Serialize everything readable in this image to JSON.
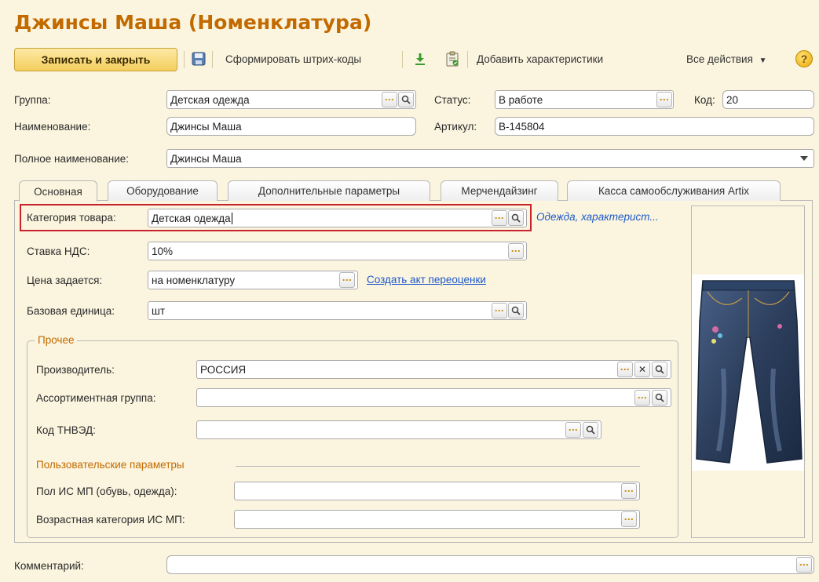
{
  "title": "Джинсы Маша (Номенклатура)",
  "toolbar": {
    "save_close": "Записать и закрыть",
    "generate_barcodes": "Сформировать штрих-коды",
    "add_characteristics": "Добавить характеристики",
    "all_actions": "Все действия",
    "help": "?"
  },
  "header": {
    "group_label": "Группа:",
    "group_value": "Детская одежда",
    "status_label": "Статус:",
    "status_value": "В работе",
    "code_label": "Код:",
    "code_value": "20",
    "name_label": "Наименование:",
    "name_value": "Джинсы Маша",
    "article_label": "Артикул:",
    "article_value": "В-145804",
    "fullname_label": "Полное наименование:",
    "fullname_value": "Джинсы Маша"
  },
  "tabs": [
    {
      "label": "Основная",
      "active": true
    },
    {
      "label": "Оборудование",
      "active": false
    },
    {
      "label": "Дополнительные параметры",
      "active": false
    },
    {
      "label": "Мерчендайзинг",
      "active": false
    },
    {
      "label": "Касса самообслуживания Artix",
      "active": false
    }
  ],
  "main": {
    "category_label": "Категория товара:",
    "category_value": "Детская одежда",
    "category_link": "Одежда, характерист...",
    "vat_label": "Ставка НДС:",
    "vat_value": "10%",
    "price_label": "Цена задается:",
    "price_value": "на номенклатуру",
    "price_link": "Создать акт переоценки",
    "unit_label": "Базовая единица:",
    "unit_value": "шт"
  },
  "other": {
    "legend": "Прочее",
    "manufacturer_label": "Производитель:",
    "manufacturer_value": "РОССИЯ",
    "assortment_label": "Ассортиментная группа:",
    "assortment_value": "",
    "tnved_label": "Код ТНВЭД:",
    "tnved_value": "",
    "user_params_legend": "Пользовательские параметры",
    "gender_label": "Пол ИС МП (обувь, одежда):",
    "gender_value": "",
    "age_label": "Возрастная категория ИС МП:",
    "age_value": ""
  },
  "comment_label": "Комментарий:",
  "comment_value": "",
  "colors": {
    "title": "#c26a00",
    "highlight": "#c8232c",
    "link": "#1e58c8",
    "background": "#fbf5df"
  },
  "icons": [
    "save-icon",
    "download-icon",
    "clipboard-icon",
    "search-icon",
    "clear-icon",
    "dropdown-icon",
    "help-icon"
  ]
}
